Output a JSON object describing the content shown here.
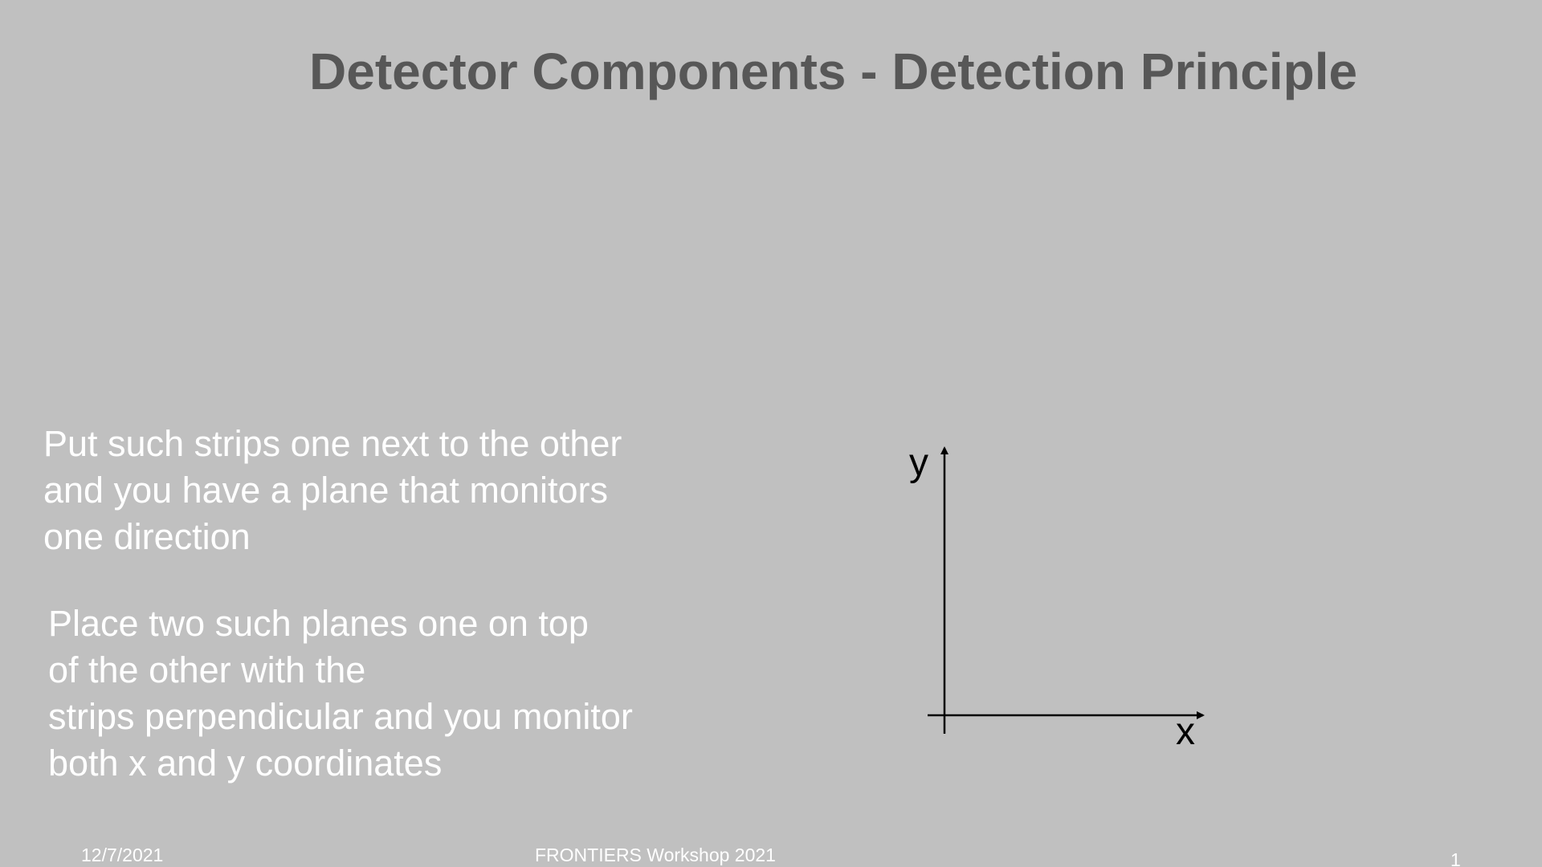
{
  "slide": {
    "title": "Detector Components - Detection Principle",
    "paragraph1": [
      "Put such strips one next to the other",
      "and you have a plane that monitors",
      "one direction"
    ],
    "paragraph2": [
      "Place two such planes one on top",
      "of the other with the",
      "strips perpendicular and you monitor",
      "both x and y coordinates"
    ],
    "diagram": {
      "y_label": "y",
      "x_label": "x"
    },
    "footer": {
      "date": "12/7/2021",
      "event": "FRONTIERS Workshop 2021",
      "page_number": "1"
    }
  },
  "colors": {
    "background": "#c0c0c0",
    "title": "#575757",
    "body_text": "#ffffff",
    "axes": "#000000"
  }
}
